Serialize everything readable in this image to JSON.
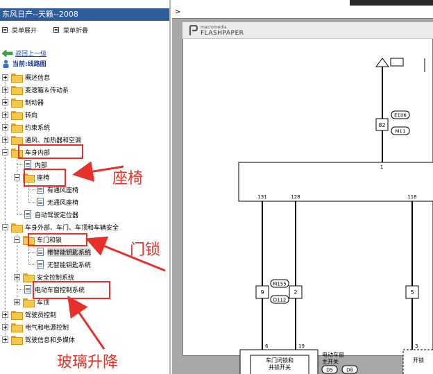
{
  "left_pane": {
    "title": "东风日产--天籁--2008",
    "menu": {
      "expand": "菜单展开",
      "collapse": "菜单折叠"
    },
    "nav": {
      "back": "返回上一级",
      "current": "当前:线路图"
    },
    "tree": {
      "n1": "概述信息",
      "n2": "变速箱＆传动系",
      "n3": "制动器",
      "n4": "转向",
      "n5": "约束系统",
      "n6": "通风、加热器和空调",
      "n7": "车身内部",
      "n7a": "内部",
      "n7b": "座椅",
      "n7b1": "有通风座椅",
      "n7b2": "无通风座椅",
      "n7c": "自动驾驶定位器",
      "n8": "车身外部、车门、车顶和车辆安全",
      "n8a": "车门和锁",
      "n8a1": "带智能钥匙系统",
      "n8a2": "无智能钥匙系统",
      "n8b": "安全控制系统",
      "n8c": "电动车窗控制系统",
      "n8d": "车顶",
      "n9": "驾驶员控制",
      "n10": "电气和电源控制",
      "n11": "驾驶信息和多媒体"
    }
  },
  "annotations": {
    "seat": "座椅",
    "door_lock": "门锁",
    "window": "玻璃升降"
  },
  "right_pane": {
    "prompt": ">",
    "viewer": {
      "brand_small": "macromedia",
      "brand_large": "FLASHPAPER"
    },
    "schematic": {
      "pin_top": "1",
      "conn_upper_pin": "82",
      "conn_upper_tags": [
        "E106",
        "M11"
      ],
      "wire_pins": [
        "131",
        "128",
        "118"
      ],
      "mid_connectors": [
        "9",
        "2",
        "5"
      ],
      "mid_tags": [
        "M155",
        "D112"
      ],
      "bottom_pins": [
        "6",
        "19",
        "3"
      ],
      "box_left": [
        "车门闭锁和",
        "并锁开关"
      ],
      "box_mid": [
        "电动车窗",
        "主开关"
      ],
      "box_mid_tags": [
        "D5",
        "D8"
      ],
      "box_right": "开锁"
    }
  },
  "colors": {
    "title_bg": "#2f5c9a",
    "annotation": "#e8302a",
    "link": "#1a4fa8"
  }
}
